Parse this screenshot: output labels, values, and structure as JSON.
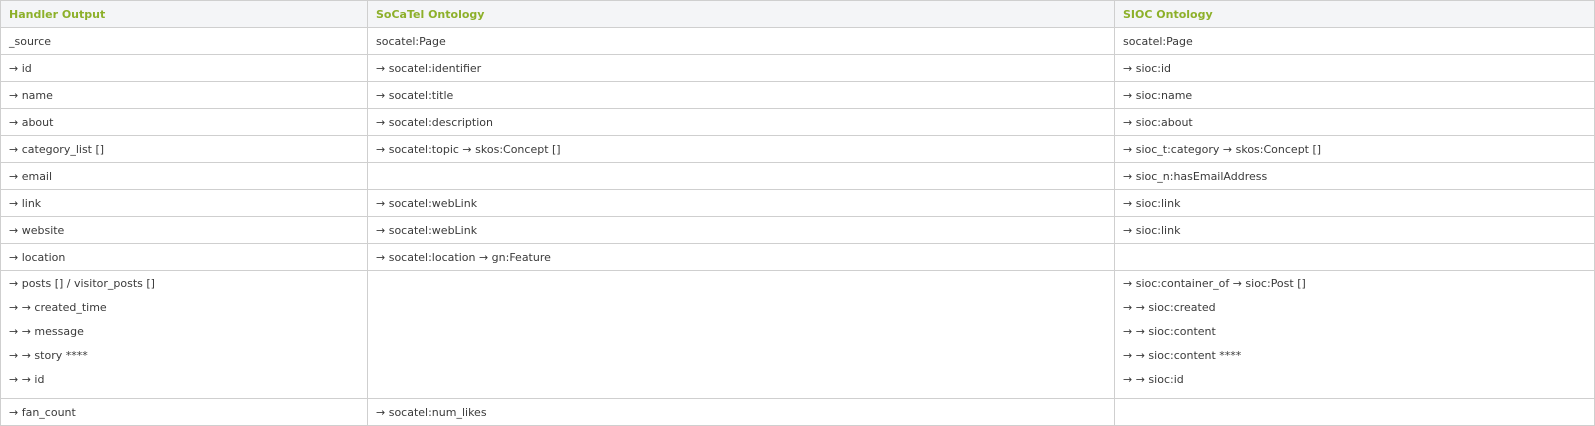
{
  "headers": [
    "Handler Output",
    "SoCaTel Ontology",
    "SIOC Ontology"
  ],
  "rows": [
    [
      "_source",
      "socatel:Page",
      "socatel:Page"
    ],
    [
      "→ id",
      "→ socatel:identifier",
      "→ sioc:id"
    ],
    [
      "→ name",
      "→ socatel:title",
      "→ sioc:name"
    ],
    [
      "→ about",
      "→ socatel:description",
      "→ sioc:about"
    ],
    [
      "→ category_list []",
      "→ socatel:topic → skos:Concept []",
      "→ sioc_t:category → skos:Concept []"
    ],
    [
      "→ email",
      "",
      "→ sioc_n:hasEmailAddress"
    ],
    [
      "→ link",
      "→ socatel:webLink",
      "→ sioc:link"
    ],
    [
      "→ website",
      "→ socatel:webLink",
      "→ sioc:link"
    ],
    [
      "→ location",
      "→ socatel:location → gn:Feature",
      ""
    ]
  ],
  "posts_row": {
    "handler": [
      "→ posts [] / visitor_posts []",
      "→ → created_time",
      "→ → message",
      "→ → story ****",
      "→ → id"
    ],
    "socatel": [],
    "sioc": [
      "→ sioc:container_of → sioc:Post []",
      "→ → sioc:created",
      "→ → sioc:content",
      "→ → sioc:content ****",
      "→ → sioc:id"
    ]
  },
  "last_row": [
    "→ fan_count",
    "→ socatel:num_likes",
    ""
  ],
  "colors": {
    "header_text": "#8db02a",
    "header_bg": "#f4f5f7",
    "border": "#cfcfcf",
    "body_text": "#3a3a3a"
  }
}
